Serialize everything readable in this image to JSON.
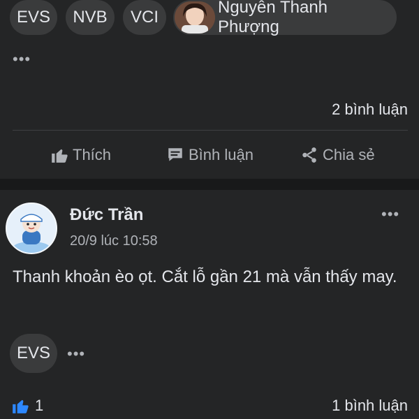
{
  "post1": {
    "tags": [
      "EVS",
      "NVB",
      "VCI"
    ],
    "tagged_user": "Nguyễn Thanh Phượng",
    "comments_count": "2 bình luận",
    "actions": {
      "like": "Thích",
      "comment": "Bình luận",
      "share": "Chia sẻ"
    }
  },
  "post2": {
    "author": "Đức Trần",
    "timestamp": "20/9 lúc 10:58",
    "text": "Thanh khoản èo ọt. Cắt lỗ gần 21 mà vẫn thấy may.",
    "tags": [
      "EVS"
    ],
    "likes": "1",
    "comments_count": "1 bình luận"
  },
  "icons": {
    "more": "more-horizontal-icon",
    "like": "thumbs-up-icon",
    "comment": "comment-bubble-icon",
    "share": "share-icon",
    "like_reaction": "like-reaction-icon"
  },
  "colors": {
    "background": "#242526",
    "chip": "#3a3b3c",
    "text_primary": "#e4e6eb",
    "text_secondary": "#b0b3b8",
    "like_blue": "#2d88ff"
  }
}
